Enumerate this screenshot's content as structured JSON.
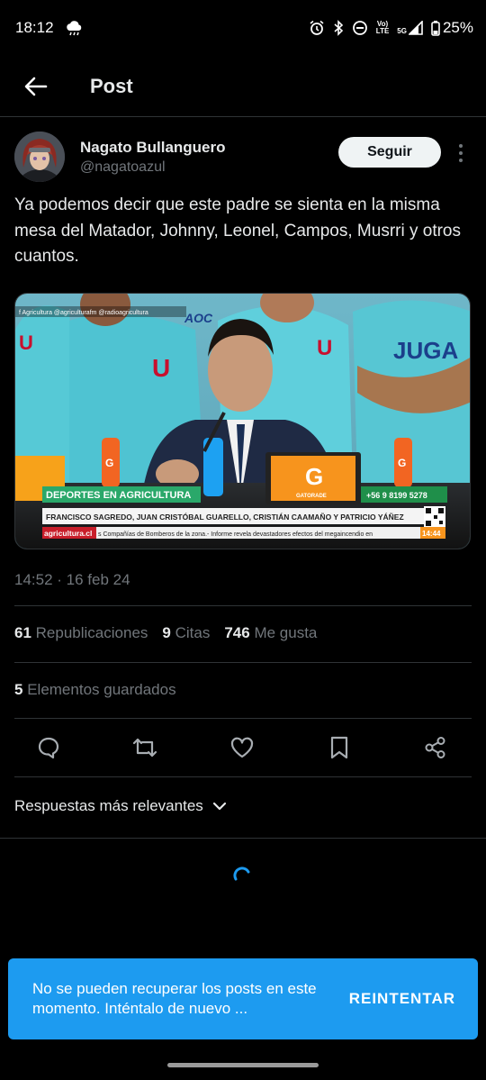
{
  "status_bar": {
    "time": "18:12",
    "network_top": "Vo)",
    "network_bottom": "LTE",
    "signal_label": "5G",
    "battery": "25%"
  },
  "header": {
    "title": "Post"
  },
  "post": {
    "author_name": "Nagato Bullanguero",
    "author_handle": "@nagatoazul",
    "follow_label": "Seguir",
    "text": "Ya podemos decir que este padre se sienta en la misma mesa del Matador, Johnny, Leonel, Campos, Musrri y otros cuantos.",
    "timestamp": "14:52 · 16 feb 24",
    "stats": {
      "reposts_count": "61",
      "reposts_label": "Republicaciones",
      "quotes_count": "9",
      "quotes_label": "Citas",
      "likes_count": "746",
      "likes_label": "Me gusta",
      "bookmarks_count": "5",
      "bookmarks_label": "Elementos guardados"
    }
  },
  "media": {
    "social_bar": "f Agricultura  @agriculturafm  @radioagricultura",
    "logo_text": "AOC",
    "jersey_logo": "U",
    "sponsor_text": "JUGA",
    "bottle_letter": "G",
    "monitor_brand": "GATORADE",
    "banner_title": "DEPORTES EN AGRICULTURA",
    "phone": "+56 9 8199 5278",
    "lower_third": "FRANCISCO SAGREDO, JUAN CRISTÓBAL GUARELLO, CRISTIÁN CAAMAÑO Y PATRICIO YÁÑEZ",
    "site": "agricultura.cl",
    "ticker": "s Compañías de Bomberos de la zona.-  Informe revela devastadores efectos del megaincendio en",
    "clock": "14:44"
  },
  "replies": {
    "sort_label": "Respuestas más relevantes"
  },
  "snackbar": {
    "message": "No se pueden recuperar los posts en este momento. Inténtalo de nuevo ...",
    "action_label": "REINTENTAR"
  },
  "icons": {
    "back": "arrow-left-icon",
    "reply": "reply-icon",
    "repost": "repost-icon",
    "like": "heart-icon",
    "bookmark": "bookmark-icon",
    "share": "share-icon"
  },
  "colors": {
    "accent": "#1d9bf0",
    "background": "#000000",
    "text": "#e7e9ea",
    "secondary": "#71767b"
  }
}
